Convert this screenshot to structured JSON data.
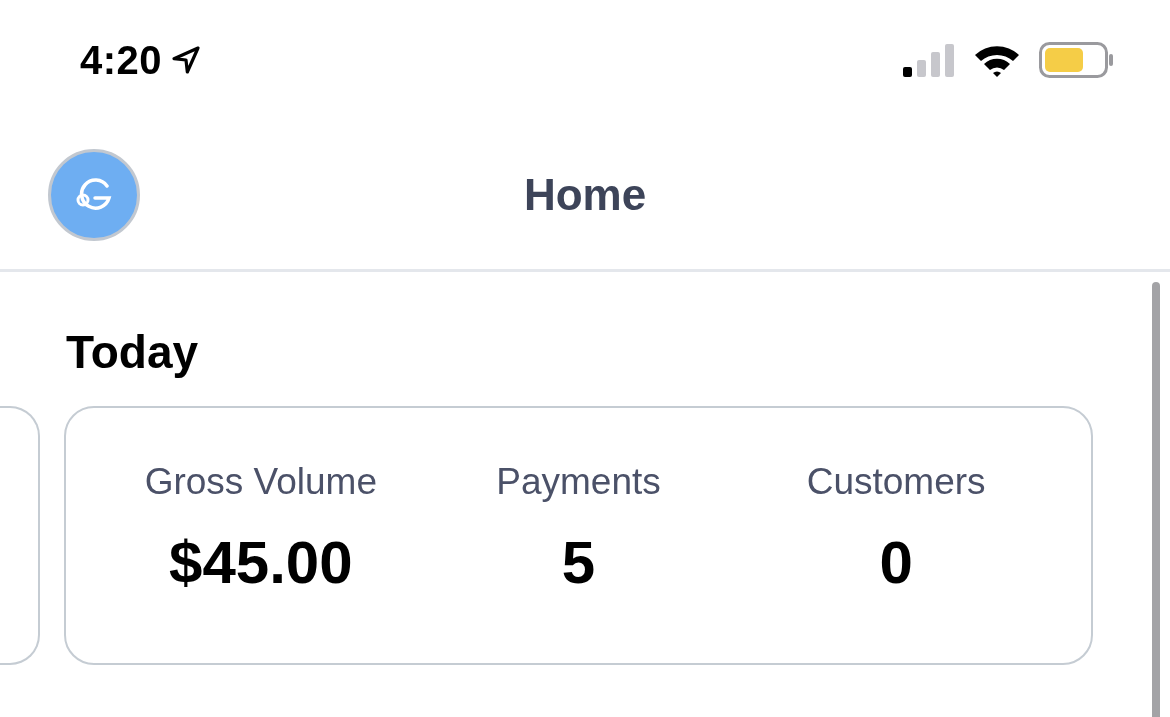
{
  "status_bar": {
    "time": "4:20"
  },
  "header": {
    "title": "Home"
  },
  "section": {
    "title": "Today"
  },
  "stats": [
    {
      "label": "Gross Volume",
      "value": "$45.00"
    },
    {
      "label": "Payments",
      "value": "5"
    },
    {
      "label": "Customers",
      "value": "0"
    }
  ]
}
